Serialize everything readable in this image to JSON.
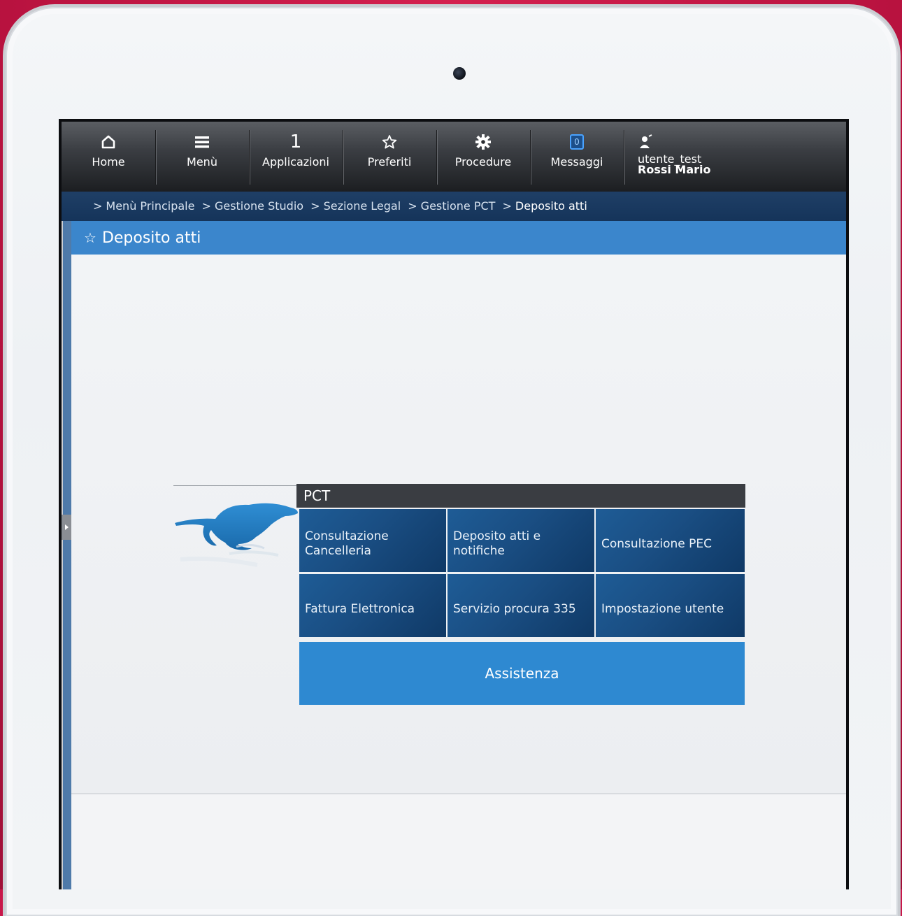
{
  "topbar": {
    "items": [
      {
        "label": "Home",
        "icon": "home-icon"
      },
      {
        "label": "Menù",
        "icon": "menu-icon"
      },
      {
        "label": "Applicazioni",
        "icon": "applications-icon",
        "glyph": "1"
      },
      {
        "label": "Preferiti",
        "icon": "star-icon"
      },
      {
        "label": "Procedure",
        "icon": "gear-icon"
      },
      {
        "label": "Messaggi",
        "icon": "message-icon",
        "badge": "0"
      }
    ],
    "user": {
      "username": "utente_test",
      "fullname": "Rossi Mario",
      "icon": "user-icon"
    }
  },
  "breadcrumb": {
    "items": [
      "Menù Principale",
      "Gestione Studio",
      "Sezione Legal",
      "Gestione PCT"
    ],
    "current": "Deposito atti",
    "separator": ">"
  },
  "page": {
    "title": "Deposito atti",
    "title_icon": "star-icon"
  },
  "panel": {
    "header": "PCT",
    "tiles": [
      "Consultazione Cancelleria",
      "Deposito atti e notifiche",
      "Consultazione PEC",
      "Fattura Elettronica",
      "Servizio procura 335",
      "Impostazione utente"
    ],
    "assist_label": "Assistenza",
    "logo": "cheetah-logo"
  },
  "colors": {
    "background": "#c8174a",
    "title_bar": "#3b86cc",
    "tile": "#1a4e83",
    "assist": "#2e89d1",
    "breadcrumb": "#15345a"
  }
}
